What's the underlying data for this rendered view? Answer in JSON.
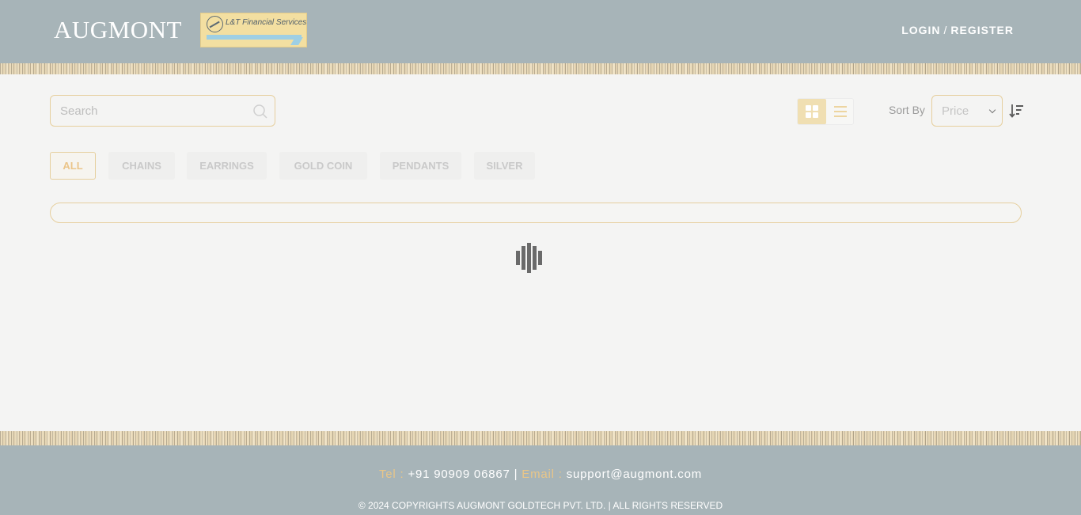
{
  "header": {
    "logo_text": "AUGMONT",
    "partner_logo_text": "L&T Financial Services",
    "login_label": "LOGIN",
    "separator": "/",
    "register_label": "REGISTER"
  },
  "toolbar": {
    "search_placeholder": "Search",
    "sort_label": "Sort By",
    "sort_value": "Price",
    "active_view": "grid"
  },
  "categories": [
    {
      "label": "ALL",
      "active": true
    },
    {
      "label": "CHAINS",
      "active": false
    },
    {
      "label": "EARRINGS",
      "active": false
    },
    {
      "label": "GOLD COIN",
      "active": false
    },
    {
      "label": "PENDANTS",
      "active": false
    },
    {
      "label": "SILVER",
      "active": false
    }
  ],
  "loading": {
    "progress_percent": 0
  },
  "footer": {
    "tel_label": "Tel :",
    "tel_value": "+91 90909 06867",
    "divider": "|",
    "email_label": "Email :",
    "email_value": "support@augmont.com",
    "copyright": "© 2024 COPYRIGHTS AUGMONT GOLDTECH PVT. LTD. | ALL RIGHTS RESERVED"
  },
  "colors": {
    "header_bg": "#a7b4b8",
    "accent_gold": "#e6cf9e",
    "active_category_text": "#ebc58a",
    "footer_label": "#e9c688"
  },
  "icons": {
    "search": "search-icon",
    "grid_view": "grid-view-icon",
    "list_view": "list-view-icon",
    "sort_order": "sort-order-icon",
    "loader": "loading-spinner-icon"
  }
}
